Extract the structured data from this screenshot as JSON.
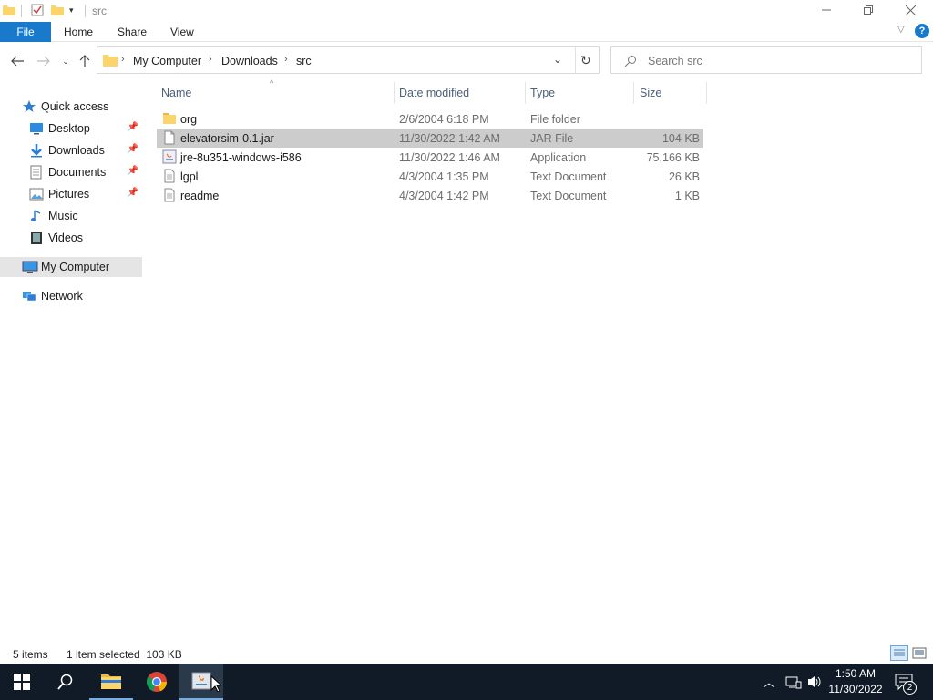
{
  "window": {
    "title": "src"
  },
  "ribbon": {
    "tabs": [
      "File",
      "Home",
      "Share",
      "View"
    ]
  },
  "address": {
    "crumbs": [
      "My Computer",
      "Downloads",
      "src"
    ]
  },
  "search": {
    "placeholder": "Search src"
  },
  "nav": {
    "quick_access": "Quick access",
    "items": [
      {
        "label": "Desktop",
        "icon": "desktop-icon",
        "pinned": true
      },
      {
        "label": "Downloads",
        "icon": "downloads-icon",
        "pinned": true
      },
      {
        "label": "Documents",
        "icon": "documents-icon",
        "pinned": true
      },
      {
        "label": "Pictures",
        "icon": "pictures-icon",
        "pinned": true
      },
      {
        "label": "Music",
        "icon": "music-icon",
        "pinned": false
      },
      {
        "label": "Videos",
        "icon": "videos-icon",
        "pinned": false
      }
    ],
    "my_computer": "My Computer",
    "network": "Network"
  },
  "columns": {
    "name": "Name",
    "date": "Date modified",
    "type": "Type",
    "size": "Size"
  },
  "files": [
    {
      "name": "org",
      "date": "2/6/2004 6:18 PM",
      "type": "File folder",
      "size": "",
      "icon": "folder-icon"
    },
    {
      "name": "elevatorsim-0.1.jar",
      "date": "11/30/2022 1:42 AM",
      "type": "JAR File",
      "size": "104 KB",
      "icon": "file-icon",
      "selected": true
    },
    {
      "name": "jre-8u351-windows-i586",
      "date": "11/30/2022 1:46 AM",
      "type": "Application",
      "size": "75,166 KB",
      "icon": "java-installer-icon"
    },
    {
      "name": "lgpl",
      "date": "4/3/2004 1:35 PM",
      "type": "Text Document",
      "size": "26 KB",
      "icon": "text-file-icon"
    },
    {
      "name": "readme",
      "date": "4/3/2004 1:42 PM",
      "type": "Text Document",
      "size": "1 KB",
      "icon": "text-file-icon"
    }
  ],
  "status": {
    "count": "5 items",
    "selection": "1 item selected  103 KB"
  },
  "clock": {
    "time": "1:50 AM",
    "date": "11/30/2022"
  },
  "notifications": {
    "count": "2"
  },
  "colors": {
    "accent": "#1979ca",
    "selection": "#cccccc",
    "taskbar": "#101b27"
  }
}
